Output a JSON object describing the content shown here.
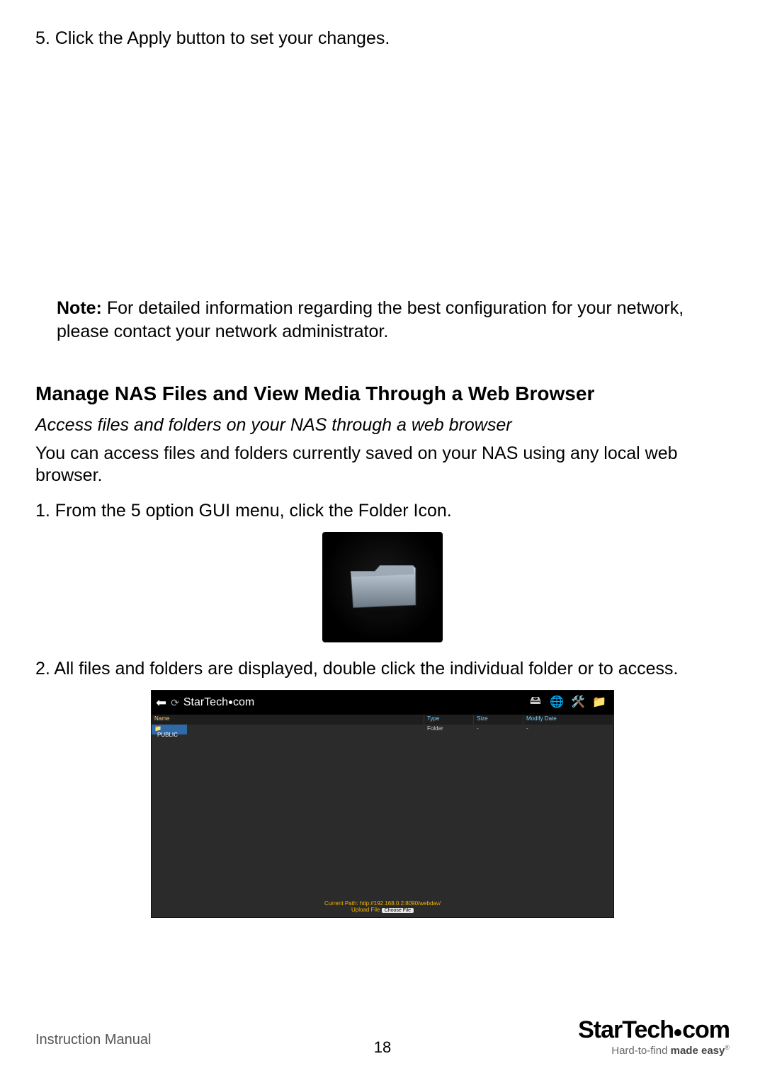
{
  "step5": "5.  Click the Apply button to set your changes.",
  "note_label": "Note:",
  "note_text": " For detailed information regarding the best configuration for your network, please contact your network administrator.",
  "section_heading": "Manage NAS Files and View Media Through a Web Browser",
  "subheading": "Access files and folders on your NAS through a web browser",
  "intro_para": "You can access files and folders currently saved on your NAS using any local web browser.",
  "step1": "1.  From the 5 option GUI menu, click the Folder Icon.",
  "step2": "2.  All files and folders are displayed, double click the individual folder or to access.",
  "file_browser": {
    "brand": "StarTech.com",
    "cols": {
      "name": "Name",
      "type": "Type",
      "size": "Size",
      "modify": "Modify Date"
    },
    "row": {
      "name": "PUBLIC",
      "type": "Folder",
      "size": "-",
      "modify": "-"
    },
    "current_path_label": "Current Path:",
    "current_path": "http://192.168.0.2:8090/webdav/",
    "upload_label": "Upload File",
    "choose_label": "Choose File"
  },
  "footer": {
    "left": "Instruction Manual",
    "page": "18",
    "brand": "StarTech.com",
    "tagline_prefix": "Hard-to-find ",
    "tagline_bold": "made easy",
    "reg": "®"
  }
}
